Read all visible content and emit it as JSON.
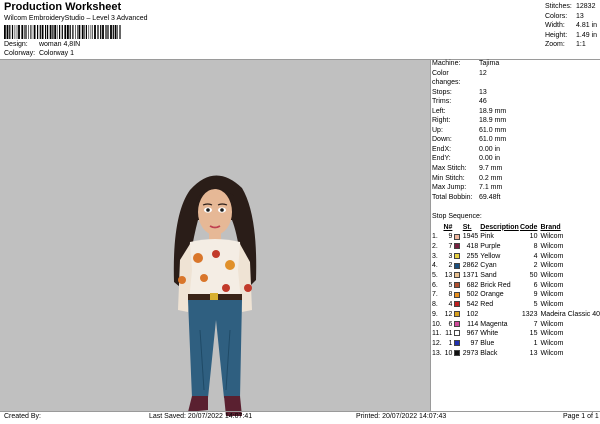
{
  "header": {
    "title": "Production Worksheet",
    "subtitle": "Wilcom EmbroideryStudio – Level 3 Advanced",
    "design_label": "Design:",
    "design_value": "woman 4,8IN",
    "colorway_label": "Colorway:",
    "colorway_value": "Colorway 1"
  },
  "summary": [
    {
      "label": "Stitches:",
      "value": "12832"
    },
    {
      "label": "Colors:",
      "value": "13"
    },
    {
      "label": "Width:",
      "value": "4.81 in"
    },
    {
      "label": "Height:",
      "value": "1.49 in"
    },
    {
      "label": "Zoom:",
      "value": "1:1"
    }
  ],
  "specs": [
    {
      "label": "Machine:",
      "value": "Tajima"
    },
    {
      "label": "Color changes:",
      "value": "12"
    },
    {
      "label": "Stops:",
      "value": "13"
    },
    {
      "label": "Trims:",
      "value": "46"
    },
    {
      "label": "Left:",
      "value": "18.9 mm"
    },
    {
      "label": "Right:",
      "value": "18.9 mm"
    },
    {
      "label": "Up:",
      "value": "61.0 mm"
    },
    {
      "label": "Down:",
      "value": "61.0 mm"
    },
    {
      "label": "EndX:",
      "value": "0.00 in"
    },
    {
      "label": "EndY:",
      "value": "0.00 in"
    },
    {
      "label": "Max Stitch:",
      "value": "9.7 mm"
    },
    {
      "label": "Min Stitch:",
      "value": "0.2 mm"
    },
    {
      "label": "Max Jump:",
      "value": "7.1 mm"
    },
    {
      "label": "Total Bobbin:",
      "value": "69.48ft"
    }
  ],
  "sequence": {
    "heading": "Stop Sequence:",
    "headers": {
      "n": "N#",
      "st": "St.",
      "desc": "Description",
      "code": "Code",
      "brand": "Brand"
    },
    "rows": [
      {
        "idx": "1.",
        "n": "9",
        "color": "#f0b8a0",
        "st": "1945",
        "desc": "Pink",
        "code": "10",
        "brand": "Wilcom"
      },
      {
        "idx": "2.",
        "n": "7",
        "color": "#7a2040",
        "st": "418",
        "desc": "Purple",
        "code": "8",
        "brand": "Wilcom"
      },
      {
        "idx": "3.",
        "n": "3",
        "color": "#e8d040",
        "st": "255",
        "desc": "Yellow",
        "code": "4",
        "brand": "Wilcom"
      },
      {
        "idx": "4.",
        "n": "2",
        "color": "#1a4f80",
        "st": "2862",
        "desc": "Cyan",
        "code": "2",
        "brand": "Wilcom"
      },
      {
        "idx": "5.",
        "n": "13",
        "color": "#e8c090",
        "st": "1371",
        "desc": "Sand",
        "code": "50",
        "brand": "Wilcom"
      },
      {
        "idx": "6.",
        "n": "5",
        "color": "#b05030",
        "st": "682",
        "desc": "Brick Red",
        "code": "6",
        "brand": "Wilcom"
      },
      {
        "idx": "7.",
        "n": "8",
        "color": "#e89020",
        "st": "502",
        "desc": "Orange",
        "code": "9",
        "brand": "Wilcom"
      },
      {
        "idx": "8.",
        "n": "4",
        "color": "#c02020",
        "st": "542",
        "desc": "Red",
        "code": "5",
        "brand": "Wilcom"
      },
      {
        "idx": "9.",
        "n": "12",
        "color": "#d8a020",
        "st": "102",
        "desc": "",
        "code": "1323",
        "brand": "Madeira Classic 40"
      },
      {
        "idx": "10.",
        "n": "6",
        "color": "#d04a9a",
        "st": "114",
        "desc": "Magenta",
        "code": "7",
        "brand": "Wilcom"
      },
      {
        "idx": "11.",
        "n": "11",
        "color": "#ffffff",
        "st": "967",
        "desc": "White",
        "code": "15",
        "brand": "Wilcom"
      },
      {
        "idx": "12.",
        "n": "1",
        "color": "#2030b0",
        "st": "97",
        "desc": "Blue",
        "code": "1",
        "brand": "Wilcom"
      },
      {
        "idx": "13.",
        "n": "10",
        "color": "#101010",
        "st": "2973",
        "desc": "Black",
        "code": "13",
        "brand": "Wilcom"
      }
    ]
  },
  "footer": {
    "created": "Created By:",
    "saved": "Last Saved: 20/07/2022 14:07:41",
    "printed": "Printed: 20/07/2022 14:07:43",
    "page": "Page 1 of 1"
  },
  "colors": {
    "canvas": "#c0c0c0",
    "hair": "#2a1d18",
    "skin": "#e6b896",
    "jeans": "#2f5f80",
    "boots": "#5a2030"
  }
}
